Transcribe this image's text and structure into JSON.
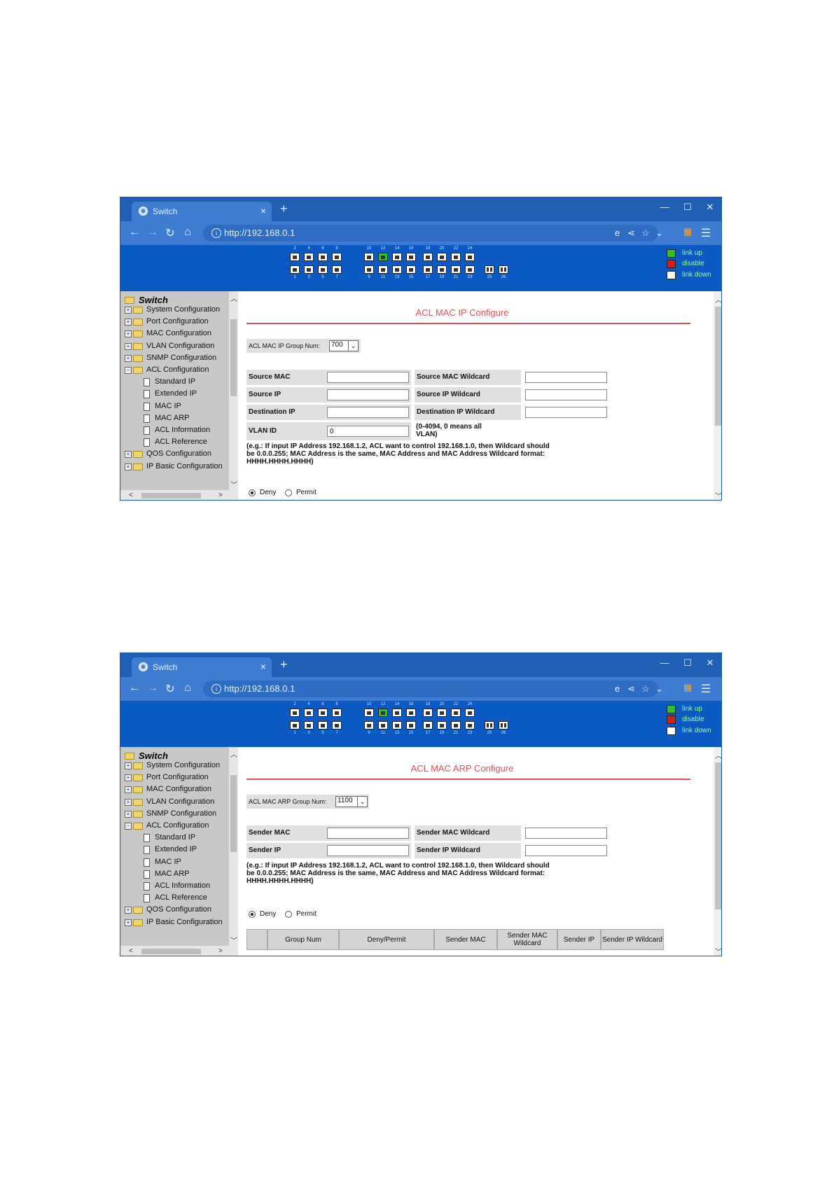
{
  "browser": {
    "tab_title": "Switch",
    "tab_close": "×",
    "new_tab": "+",
    "minimize": "—",
    "maximize": "☐",
    "close": "✕",
    "url": "http://192.168.0.1",
    "icons": [
      "back-icon",
      "forward-icon",
      "reload-icon",
      "home-icon",
      "info-icon",
      "ie-icon",
      "share-icon",
      "star-icon",
      "chevron-down-icon",
      "extensions-icon",
      "menu-icon"
    ]
  },
  "banner": {
    "top_numbers": [
      "2",
      "4",
      "6",
      "8",
      "10",
      "12",
      "14",
      "16",
      "18",
      "20",
      "22",
      "24"
    ],
    "bottom_numbers": [
      "1",
      "3",
      "5",
      "7",
      "9",
      "11",
      "13",
      "15",
      "17",
      "19",
      "21",
      "23",
      "25",
      "26"
    ],
    "green_port": "12",
    "legend": [
      "link up",
      "disable",
      "link down"
    ],
    "colors": {
      "background": "#0b59c2",
      "link_up": "#2ec12e",
      "disable": "#d21f1f"
    }
  },
  "sidebar": {
    "root": "Switch",
    "items": [
      {
        "label": "System Configuration",
        "type": "folder"
      },
      {
        "label": "Port Configuration",
        "type": "folder"
      },
      {
        "label": "MAC Configuration",
        "type": "folder"
      },
      {
        "label": "VLAN Configuration",
        "type": "folder"
      },
      {
        "label": "SNMP Configuration",
        "type": "folder"
      },
      {
        "label": "ACL Configuration",
        "type": "folder-open"
      },
      {
        "label": "Standard IP",
        "type": "doc"
      },
      {
        "label": "Extended IP",
        "type": "doc"
      },
      {
        "label": "MAC IP",
        "type": "doc"
      },
      {
        "label": "MAC ARP",
        "type": "doc"
      },
      {
        "label": "ACL Information",
        "type": "doc"
      },
      {
        "label": "ACL Reference",
        "type": "doc"
      },
      {
        "label": "QOS Configuration",
        "type": "folder"
      },
      {
        "label": "IP Basic Configuration",
        "type": "folder"
      }
    ]
  },
  "page1": {
    "title": "ACL MAC IP Configure",
    "group_label": "ACL MAC IP Group Num:",
    "group_value": "700",
    "source_mac": "Source MAC",
    "source_mac_wildcard": "Source MAC Wildcard",
    "source_ip": "Source IP",
    "source_ip_wildcard": "Source IP Wildcard",
    "destination_ip": "Destination IP",
    "destination_ip_wildcard": "Destination IP Wildcard",
    "vlan_id": "VLAN ID",
    "vlan_value": "0",
    "vlan_hint_1": "(0-4094, 0 means all",
    "vlan_hint_2": "VLAN)",
    "hint_1": "(e.g.: If input IP Address 192.168.1.2, ACL want to control 192.168.1.0, then Wildcard should",
    "hint_2": "be 0.0.0.255; MAC Address is the same, MAC Address and MAC Address Wildcard format:",
    "hint_3": "HHHH.HHHH.HHHH)",
    "deny": "Deny",
    "permit": "Permit"
  },
  "page2": {
    "title": "ACL MAC ARP Configure",
    "group_label": "ACL MAC ARP Group Num:",
    "group_value": "1100",
    "sender_mac": "Sender MAC",
    "sender_mac_wildcard": "Sender MAC Wildcard",
    "sender_ip": "Sender IP",
    "sender_ip_wildcard": "Sender IP Wildcard",
    "hint_1": "(e.g.: If input IP Address 192.168.1.2, ACL want to control 192.168.1.0, then Wildcard should",
    "hint_2": "be 0.0.0.255; MAC Address is the same, MAC Address and MAC Address Wildcard format:",
    "hint_3": "HHHH.HHHH.HHHH)",
    "deny": "Deny",
    "permit": "Permit",
    "table_headers": [
      "Group Num",
      "Deny/Permit",
      "Sender MAC",
      "Sender MAC Wildcard",
      "Sender IP",
      "Sender IP Wildcard"
    ]
  }
}
